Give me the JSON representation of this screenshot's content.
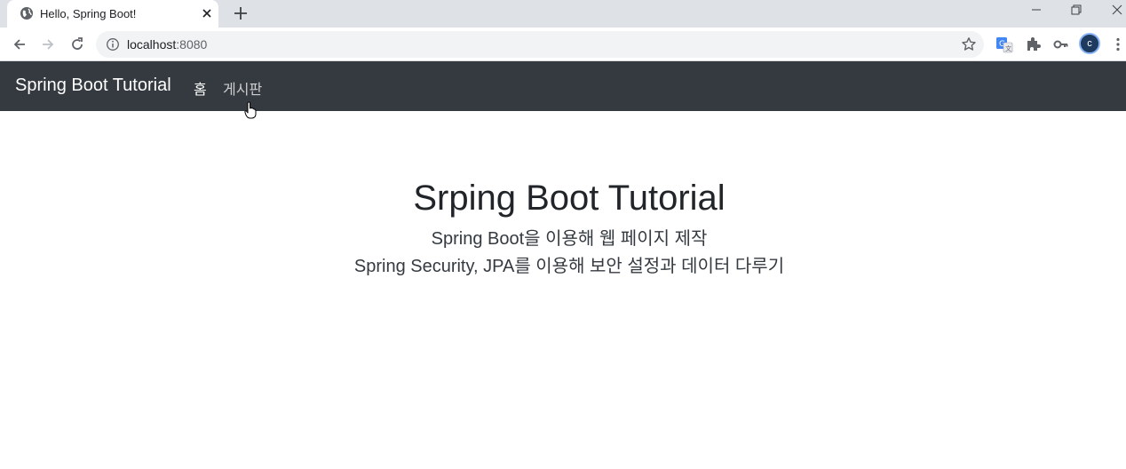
{
  "browser": {
    "tab": {
      "title": "Hello, Spring Boot!"
    },
    "address": {
      "host": "localhost",
      "port": ":8080"
    },
    "profile_initial": "c"
  },
  "navbar": {
    "brand": "Spring Boot Tutorial",
    "links": [
      {
        "label": "홈"
      },
      {
        "label": "게시판"
      }
    ],
    "background": "#343a40"
  },
  "hero": {
    "title": "Srping Boot Tutorial",
    "lines": [
      "Spring Boot을 이용해 웹 페이지 제작",
      "Spring Security, JPA를 이용해 보안 설정과 데이터 다루기"
    ]
  }
}
